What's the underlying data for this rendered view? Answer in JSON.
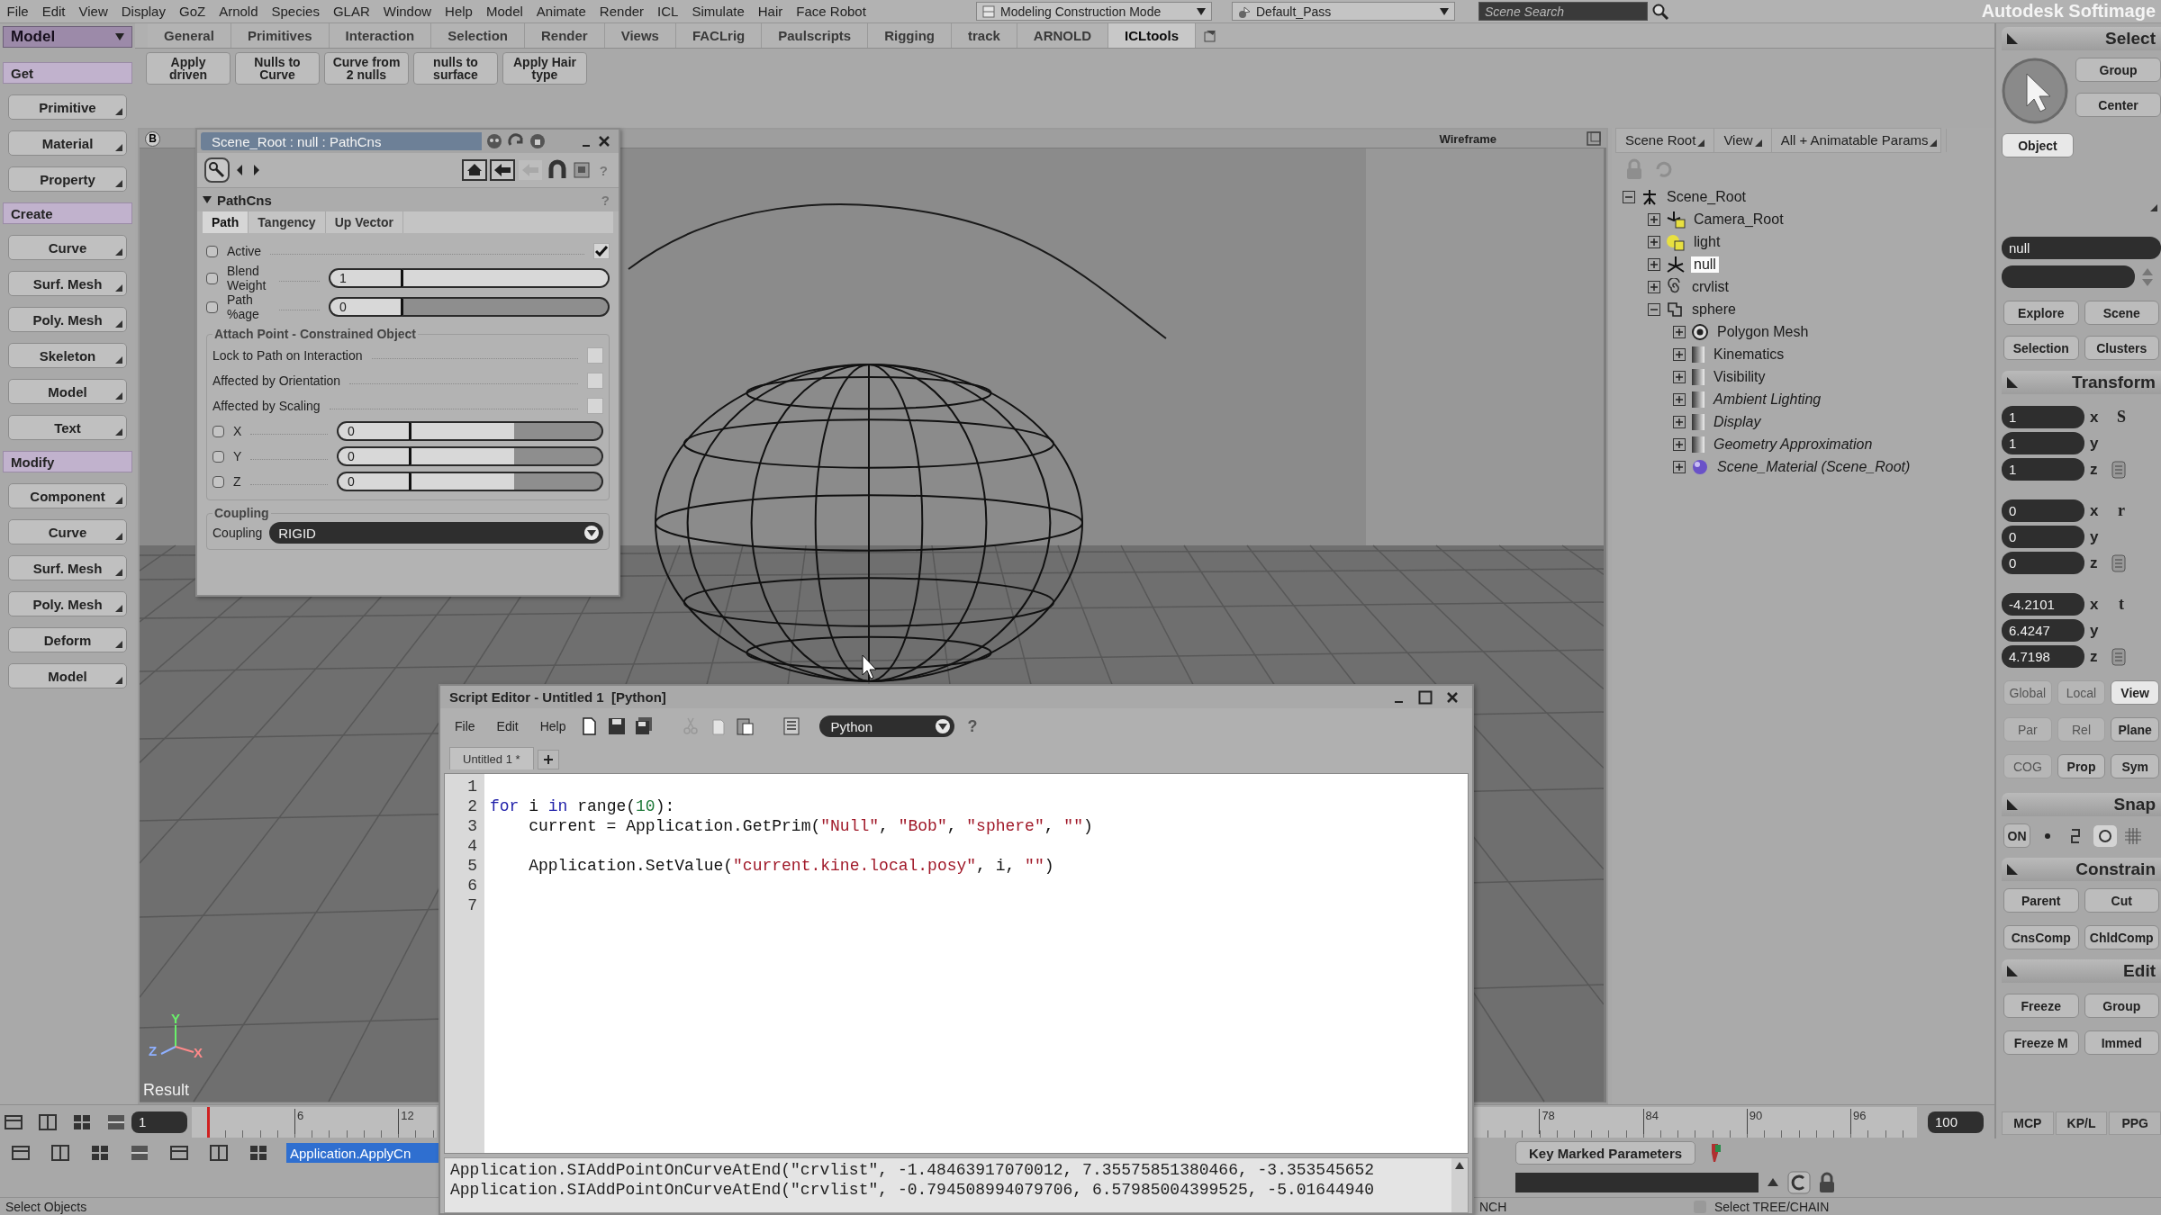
{
  "menu_bar": {
    "items": [
      "File",
      "Edit",
      "View",
      "Display",
      "GoZ",
      "Arnold",
      "Species",
      "GLAR",
      "Window",
      "Help",
      "Model",
      "Animate",
      "Render",
      "ICL",
      "Simulate",
      "Hair",
      "Face Robot"
    ],
    "mode": "Modeling Construction Mode",
    "pass": "Default_Pass",
    "search": {
      "placeholder": "Scene Search"
    },
    "brand": "Autodesk Softimage"
  },
  "toolbar": {
    "mode": "Model",
    "tabs": [
      {
        "label": "General",
        "selected": false
      },
      {
        "label": "Primitives",
        "selected": false
      },
      {
        "label": "Interaction",
        "selected": false
      },
      {
        "label": "Selection",
        "selected": false
      },
      {
        "label": "Render",
        "selected": false
      },
      {
        "label": "Views",
        "selected": false
      },
      {
        "label": "FACLrig",
        "selected": false
      },
      {
        "label": "Paulscripts",
        "selected": false
      },
      {
        "label": "Rigging",
        "selected": false
      },
      {
        "label": "track",
        "selected": false
      },
      {
        "label": "ARNOLD",
        "selected": false
      },
      {
        "label": "ICLtools",
        "selected": true
      }
    ],
    "buttons": [
      "Apply driven",
      "Nulls to Curve",
      "Curve from 2 nulls",
      "nulls to surface",
      "Apply Hair type"
    ]
  },
  "left_panel": {
    "items": [
      {
        "kind": "header",
        "label": "Get"
      },
      {
        "kind": "button",
        "label": "Primitive"
      },
      {
        "kind": "button",
        "label": "Material"
      },
      {
        "kind": "button",
        "label": "Property"
      },
      {
        "kind": "header",
        "label": "Create"
      },
      {
        "kind": "button",
        "label": "Curve"
      },
      {
        "kind": "button",
        "label": "Surf. Mesh"
      },
      {
        "kind": "button",
        "label": "Poly. Mesh"
      },
      {
        "kind": "button",
        "label": "Skeleton"
      },
      {
        "kind": "button",
        "label": "Model"
      },
      {
        "kind": "button",
        "label": "Text"
      },
      {
        "kind": "header",
        "label": "Modify"
      },
      {
        "kind": "button",
        "label": "Component"
      },
      {
        "kind": "button",
        "label": "Curve"
      },
      {
        "kind": "button",
        "label": "Surf. Mesh"
      },
      {
        "kind": "button",
        "label": "Poly. Mesh"
      },
      {
        "kind": "button",
        "label": "Deform"
      },
      {
        "kind": "button",
        "label": "Model"
      }
    ]
  },
  "viewport": {
    "camera_button": "B",
    "view_mode": "Wireframe",
    "overlay": "Result",
    "axes": [
      {
        "label": "Y",
        "color": "#6af06a"
      },
      {
        "label": "Z",
        "color": "#8fb0ff"
      },
      {
        "label": "X",
        "color": "#ff8a8a"
      }
    ]
  },
  "property_editor": {
    "title": "Scene_Root : null : PathCns",
    "help": "?",
    "section": "PathCns",
    "tabs": [
      {
        "label": "Path",
        "selected": true
      },
      {
        "label": "Tangency",
        "selected": false
      },
      {
        "label": "Up Vector",
        "selected": false
      }
    ],
    "params": [
      {
        "kind": "check",
        "label": "Active",
        "checked": true,
        "animated": false
      },
      {
        "kind": "slider",
        "label": "Blend Weight",
        "value": "1",
        "level": 1,
        "animated": false
      },
      {
        "kind": "slider",
        "label": "Path %age",
        "value": "0",
        "level": 0,
        "animated": false
      }
    ],
    "attach": {
      "title": "Attach Point - Constrained Object",
      "params": [
        {
          "kind": "check",
          "label": "Lock to Path on Interaction",
          "checked": false
        },
        {
          "kind": "check",
          "label": "Affected by Orientation",
          "checked": false
        },
        {
          "kind": "check",
          "label": "Affected by Scaling",
          "checked": false
        },
        {
          "kind": "slider",
          "label": "X",
          "value": "0",
          "level": 0.54,
          "animated": false
        },
        {
          "kind": "slider",
          "label": "Y",
          "value": "0",
          "level": 0.54,
          "animated": false
        },
        {
          "kind": "slider",
          "label": "Z",
          "value": "0",
          "level": 0.54,
          "animated": false
        }
      ]
    },
    "coupling": {
      "title": "Coupling",
      "label": "Coupling",
      "value": "RIGID"
    }
  },
  "explorer": {
    "tabs": [
      "Scene Root",
      "View",
      "All + Animatable Params"
    ],
    "tree": [
      {
        "label": "Scene_Root",
        "kind": "scene_root",
        "expanded": true,
        "selected": false,
        "shared": false,
        "children": [
          {
            "label": "Camera_Root",
            "kind": "camera",
            "expanded": false,
            "selected": false,
            "shared": false
          },
          {
            "label": "light",
            "kind": "light",
            "expanded": false,
            "selected": false,
            "shared": false
          },
          {
            "label": "null",
            "kind": "null",
            "expanded": false,
            "selected": true,
            "shared": false
          },
          {
            "label": "crvlist",
            "kind": "curve",
            "expanded": false,
            "selected": false,
            "shared": false
          },
          {
            "label": "sphere",
            "kind": "model",
            "expanded": true,
            "selected": false,
            "shared": false,
            "children": [
              {
                "label": "Polygon Mesh",
                "kind": "mesh",
                "expanded": false,
                "selected": false,
                "shared": false
              },
              {
                "label": "Kinematics",
                "kind": "property",
                "expanded": false,
                "selected": false,
                "shared": false
              },
              {
                "label": "Visibility",
                "kind": "property",
                "expanded": false,
                "selected": false,
                "shared": false
              },
              {
                "label": "Ambient Lighting",
                "kind": "property",
                "expanded": false,
                "selected": false,
                "shared": true
              },
              {
                "label": "Display",
                "kind": "property",
                "expanded": false,
                "selected": false,
                "shared": true
              },
              {
                "label": "Geometry Approximation",
                "kind": "property",
                "expanded": false,
                "selected": false,
                "shared": true
              },
              {
                "label": "Scene_Material (Scene_Root)",
                "kind": "material",
                "expanded": false,
                "selected": false,
                "shared": true
              }
            ]
          }
        ]
      }
    ]
  },
  "right_panel": {
    "select": {
      "title": "Select",
      "buttons": [
        "Group",
        "Center"
      ],
      "filter": {
        "label": "Object",
        "selected": true
      },
      "name_field": "null",
      "buttons_2": [
        "Explore",
        "Scene",
        "Selection",
        "Clusters"
      ]
    },
    "transform": {
      "title": "Transform",
      "groups": [
        {
          "label": "S",
          "rows": [
            {
              "value": "1",
              "axis": "x"
            },
            {
              "value": "1",
              "axis": "y"
            },
            {
              "value": "1",
              "axis": "z"
            }
          ]
        },
        {
          "label": "r",
          "rows": [
            {
              "value": "0",
              "axis": "x"
            },
            {
              "value": "0",
              "axis": "y"
            },
            {
              "value": "0",
              "axis": "z"
            }
          ]
        },
        {
          "label": "t",
          "rows": [
            {
              "value": "-4.2101",
              "axis": "x"
            },
            {
              "value": "6.4247",
              "axis": "y"
            },
            {
              "value": "4.7198",
              "axis": "z"
            }
          ]
        }
      ],
      "reference": [
        [
          {
            "label": "Global",
            "disabled": true,
            "selected": false
          },
          {
            "label": "Local",
            "disabled": true,
            "selected": false
          },
          {
            "label": "View",
            "disabled": false,
            "selected": true
          }
        ],
        [
          {
            "label": "Par",
            "disabled": true,
            "selected": false
          },
          {
            "label": "Rel",
            "disabled": true,
            "selected": false
          },
          {
            "label": "Plane",
            "disabled": false,
            "selected": false
          }
        ],
        [
          {
            "label": "COG",
            "disabled": true,
            "selected": false
          },
          {
            "label": "Prop",
            "disabled": false,
            "selected": false
          },
          {
            "label": "Sym",
            "disabled": false,
            "selected": false
          }
        ]
      ]
    },
    "snap": {
      "title": "Snap",
      "toggle": "ON"
    },
    "constrain": {
      "title": "Constrain",
      "buttons": [
        "Parent",
        "Cut",
        "CnsComp",
        "ChldComp"
      ]
    },
    "edit": {
      "title": "Edit",
      "buttons": [
        "Freeze",
        "Group",
        "Freeze M",
        "Immed"
      ]
    },
    "tabs": [
      {
        "label": "MCP",
        "selected": false
      },
      {
        "label": "KP/L",
        "selected": false
      },
      {
        "label": "PPG",
        "selected": false
      }
    ]
  },
  "timeline": {
    "current_frame": "1",
    "ticks_start": [
      "6",
      "12"
    ],
    "ticks_end": [
      "78",
      "84",
      "90",
      "96"
    ],
    "end_frame": "100"
  },
  "command_line": {
    "value": "Application.ApplyCn",
    "key_button": "Key Marked Parameters"
  },
  "status_bar": {
    "left": "Select Objects",
    "middle": "NCH",
    "right": "Select TREE/CHAIN"
  },
  "script_editor": {
    "title": "Script Editor - Untitled 1  [Python]",
    "menus": [
      "File",
      "Edit",
      "Help"
    ],
    "language": "Python",
    "help": "?",
    "tab": "Untitled 1 *",
    "code": [
      {
        "number": "1"
      },
      {
        "number": "2",
        "segments": [
          {
            "kind": "keyword",
            "text": "for"
          },
          {
            "kind": "plain",
            "text": " i "
          },
          {
            "kind": "keyword",
            "text": "in"
          },
          {
            "kind": "plain",
            "text": " range("
          },
          {
            "kind": "number",
            "text": "10"
          },
          {
            "kind": "plain",
            "text": "):"
          }
        ]
      },
      {
        "number": "3",
        "segments": [
          {
            "kind": "plain",
            "text": "    current = Application.GetPrim("
          },
          {
            "kind": "string",
            "text": "\"Null\""
          },
          {
            "kind": "plain",
            "text": ", "
          },
          {
            "kind": "string",
            "text": "\"Bob\""
          },
          {
            "kind": "plain",
            "text": ", "
          },
          {
            "kind": "string",
            "text": "\"sphere\""
          },
          {
            "kind": "plain",
            "text": ", "
          },
          {
            "kind": "string",
            "text": "\"\""
          },
          {
            "kind": "plain",
            "text": ")"
          }
        ]
      },
      {
        "number": "4"
      },
      {
        "number": "5",
        "segments": [
          {
            "kind": "plain",
            "text": "    Application.SetValue("
          },
          {
            "kind": "string",
            "text": "\"current.kine.local.posy\""
          },
          {
            "kind": "plain",
            "text": ", i, "
          },
          {
            "kind": "string",
            "text": "\"\""
          },
          {
            "kind": "plain",
            "text": ")"
          }
        ]
      },
      {
        "number": "6"
      },
      {
        "number": "7"
      }
    ],
    "output": [
      "Application.SIAddPointOnCurveAtEnd(\"crvlist\", -1.48463917070012, 7.35575851380466, -3.353545652",
      "Application.SIAddPointOnCurveAtEnd(\"crvlist\", -0.794508994079706, 6.57985004399525, -5.01644940"
    ]
  }
}
